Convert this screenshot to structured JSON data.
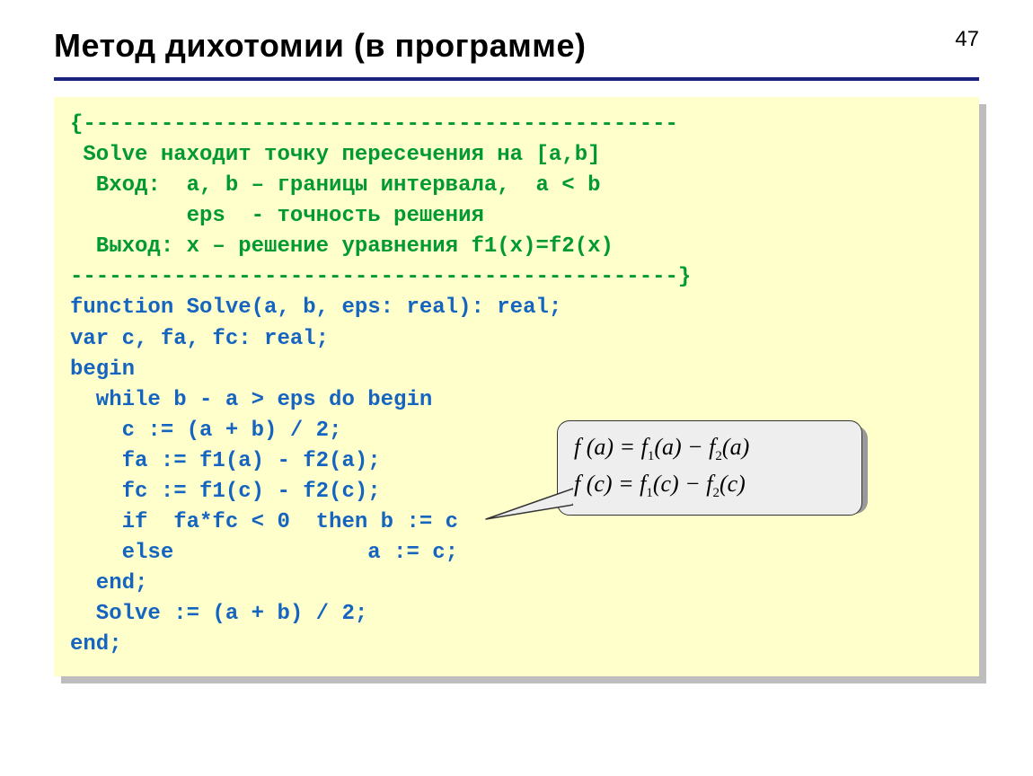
{
  "page_number": "47",
  "title": "Метод дихотомии (в программе)",
  "code": {
    "l1": "{----------------------------------------------",
    "l2": " Solve находит точку пересечения на [a,b]",
    "l3": "  Вход:  a, b – границы интервала,  a < b",
    "l4": "         eps  - точность решения",
    "l5": "  Выход: x – решение уравнения f1(x)=f2(x)",
    "l6": "-----------------------------------------------}",
    "l7": "function Solve(a, b, eps: real): real;",
    "l8": "var c, fa, fc: real;",
    "l9": "begin",
    "l10": "  while b - a > eps do begin",
    "l11": "    c := (a + b) / 2;",
    "l12": "    fa := f1(a) - f2(a);",
    "l13": "    fc := f1(c) - f2(c);",
    "l14": "    if  fa*fc < 0  then b := c",
    "l15": "    else               a := c;",
    "l16": "  end;",
    "l17": "  Solve := (a + b) / 2;",
    "l18": "end;"
  },
  "callout": {
    "line1_prefix": "f (a) = f",
    "line1_sub1": "1",
    "line1_mid": "(a) − f",
    "line1_sub2": "2",
    "line1_suffix": "(a)",
    "line2_prefix": "f (c) = f",
    "line2_sub1": "1",
    "line2_mid": "(c) − f",
    "line2_sub2": "2",
    "line2_suffix": "(c)"
  }
}
